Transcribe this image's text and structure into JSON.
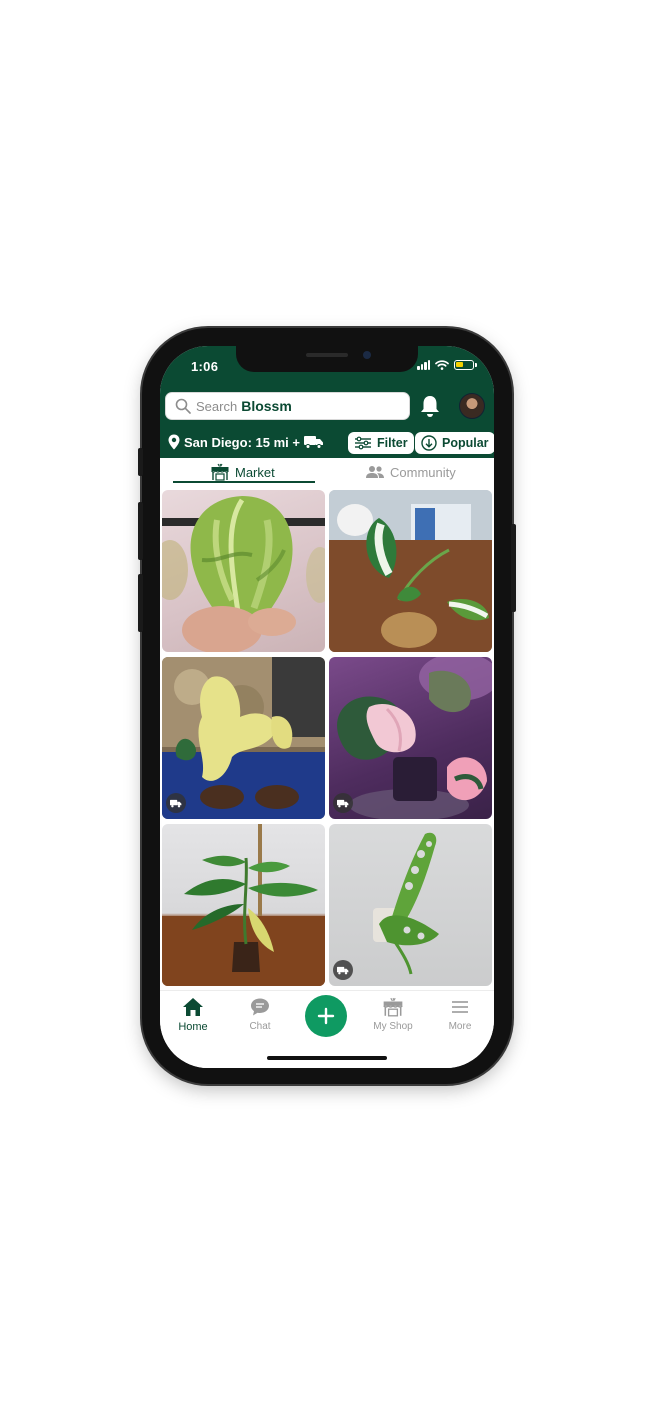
{
  "status_bar": {
    "time": "1:06"
  },
  "search": {
    "placeholder": "Search",
    "brand": "Blossm"
  },
  "location": {
    "text": "San Diego: 15 mi +"
  },
  "filters": {
    "filter_label": "Filter",
    "sort_label": "Popular"
  },
  "tabs": [
    {
      "label": "Market",
      "active": true
    },
    {
      "label": "Community",
      "active": false
    }
  ],
  "listings": [
    {
      "name": "variegated-heart-leaf",
      "shipping": false
    },
    {
      "name": "variegated-cutting-in-water",
      "shipping": false
    },
    {
      "name": "yellow-lobed-leaf",
      "shipping": true
    },
    {
      "name": "pink-variegated-philodendron",
      "shipping": true
    },
    {
      "name": "variegated-philodendron-pot",
      "shipping": false
    },
    {
      "name": "monstera-adansonii-cutting",
      "shipping": true
    }
  ],
  "bottom_nav": [
    {
      "label": "Home",
      "icon": "home-icon",
      "active": true
    },
    {
      "label": "Chat",
      "icon": "chat-icon",
      "active": false
    },
    {
      "label": "",
      "icon": "plus-icon",
      "active": false
    },
    {
      "label": "My Shop",
      "icon": "shop-icon",
      "active": false
    },
    {
      "label": "More",
      "icon": "menu-icon",
      "active": false
    }
  ],
  "colors": {
    "brand_green": "#0b4a33",
    "accent_green": "#0f9a62",
    "inactive_gray": "#9a9a9a"
  }
}
